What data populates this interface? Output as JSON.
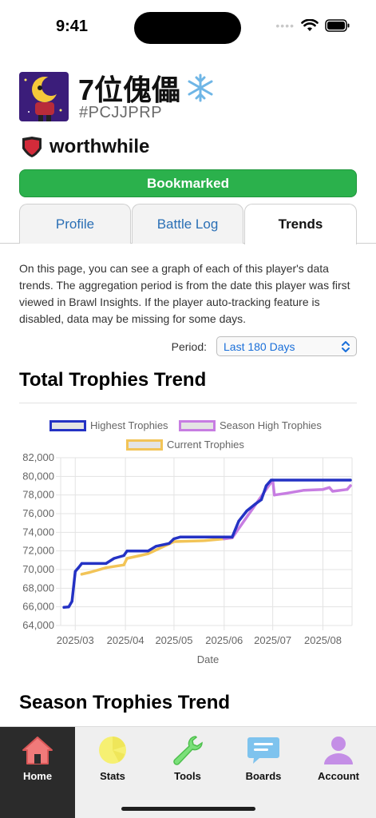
{
  "status_bar": {
    "time": "9:41"
  },
  "player": {
    "name": "7位傀儡",
    "tag": "#PCJJPRP",
    "club_name": "worthwhile",
    "bookmark_label": "Bookmarked"
  },
  "tabs": [
    {
      "label": "Profile",
      "active": false
    },
    {
      "label": "Battle Log",
      "active": false
    },
    {
      "label": "Trends",
      "active": true
    }
  ],
  "description": "On this page, you can see a graph of each of this player's data trends. The aggregation period is from the date this player was first viewed in Brawl Insights. If the player auto-tracking feature is disabled, data may be missing for some days.",
  "period": {
    "label": "Period:",
    "value": "Last 180 Days"
  },
  "sections": {
    "total_trophies_title": "Total Trophies Trend",
    "season_trophies_title": "Season Trophies Trend"
  },
  "chart_data": {
    "type": "line",
    "xlabel": "Date",
    "ylabel": "",
    "ylim": [
      64000,
      82000
    ],
    "y_ticks": [
      "82,000",
      "80,000",
      "78,000",
      "76,000",
      "74,000",
      "72,000",
      "70,000",
      "68,000",
      "66,000",
      "64,000"
    ],
    "x_ticks": [
      "2025/03",
      "2025/04",
      "2025/05",
      "2025/06",
      "2025/07",
      "2025/08"
    ],
    "grid": true,
    "legend_position": "top",
    "series": [
      {
        "name": "Highest Trophies",
        "color": "#2432c4",
        "points": [
          [
            "2025-02-22",
            65950
          ],
          [
            "2025-02-25",
            66000
          ],
          [
            "2025-02-27",
            66600
          ],
          [
            "2025-03-01",
            69800
          ],
          [
            "2025-03-03",
            70200
          ],
          [
            "2025-03-05",
            70650
          ],
          [
            "2025-03-20",
            70650
          ],
          [
            "2025-03-25",
            71200
          ],
          [
            "2025-03-31",
            71500
          ],
          [
            "2025-04-02",
            72000
          ],
          [
            "2025-04-15",
            72000
          ],
          [
            "2025-04-20",
            72500
          ],
          [
            "2025-04-28",
            72800
          ],
          [
            "2025-05-01",
            73300
          ],
          [
            "2025-05-05",
            73500
          ],
          [
            "2025-06-01",
            73500
          ],
          [
            "2025-06-06",
            73500
          ],
          [
            "2025-06-10",
            75200
          ],
          [
            "2025-06-15",
            76300
          ],
          [
            "2025-06-20",
            77000
          ],
          [
            "2025-06-24",
            77500
          ],
          [
            "2025-06-27",
            79000
          ],
          [
            "2025-06-30",
            79600
          ],
          [
            "2025-08-18",
            79600
          ]
        ]
      },
      {
        "name": "Season High Trophies",
        "color": "#c77de2",
        "points": [
          [
            "2025-06-01",
            73300
          ],
          [
            "2025-06-06",
            73400
          ],
          [
            "2025-07-01",
            79600
          ],
          [
            "2025-07-02",
            78000
          ],
          [
            "2025-07-10",
            78200
          ],
          [
            "2025-07-20",
            78500
          ],
          [
            "2025-08-01",
            78600
          ],
          [
            "2025-08-05",
            78800
          ],
          [
            "2025-08-07",
            78400
          ],
          [
            "2025-08-16",
            78600
          ],
          [
            "2025-08-18",
            79000
          ]
        ]
      },
      {
        "name": "Current Trophies",
        "color": "#f2c457",
        "points": [
          [
            "2025-03-05",
            69500
          ],
          [
            "2025-03-10",
            69700
          ],
          [
            "2025-03-20",
            70200
          ],
          [
            "2025-03-31",
            70500
          ],
          [
            "2025-04-02",
            71200
          ],
          [
            "2025-04-10",
            71500
          ],
          [
            "2025-04-15",
            71700
          ],
          [
            "2025-05-01",
            73000
          ],
          [
            "2025-05-20",
            73100
          ],
          [
            "2025-06-01",
            73300
          ],
          [
            "2025-06-06",
            73400
          ]
        ]
      }
    ]
  },
  "nav": [
    {
      "label": "Home",
      "icon": "home-icon",
      "active": true
    },
    {
      "label": "Stats",
      "icon": "pie-chart-icon",
      "active": false
    },
    {
      "label": "Tools",
      "icon": "wrench-icon",
      "active": false
    },
    {
      "label": "Boards",
      "icon": "chat-bubble-icon",
      "active": false
    },
    {
      "label": "Account",
      "icon": "person-icon",
      "active": false
    }
  ],
  "colors": {
    "bookmark_green": "#2bb14c",
    "link_blue": "#2a6fb5",
    "nav_active_bg": "#2b2b2b"
  }
}
